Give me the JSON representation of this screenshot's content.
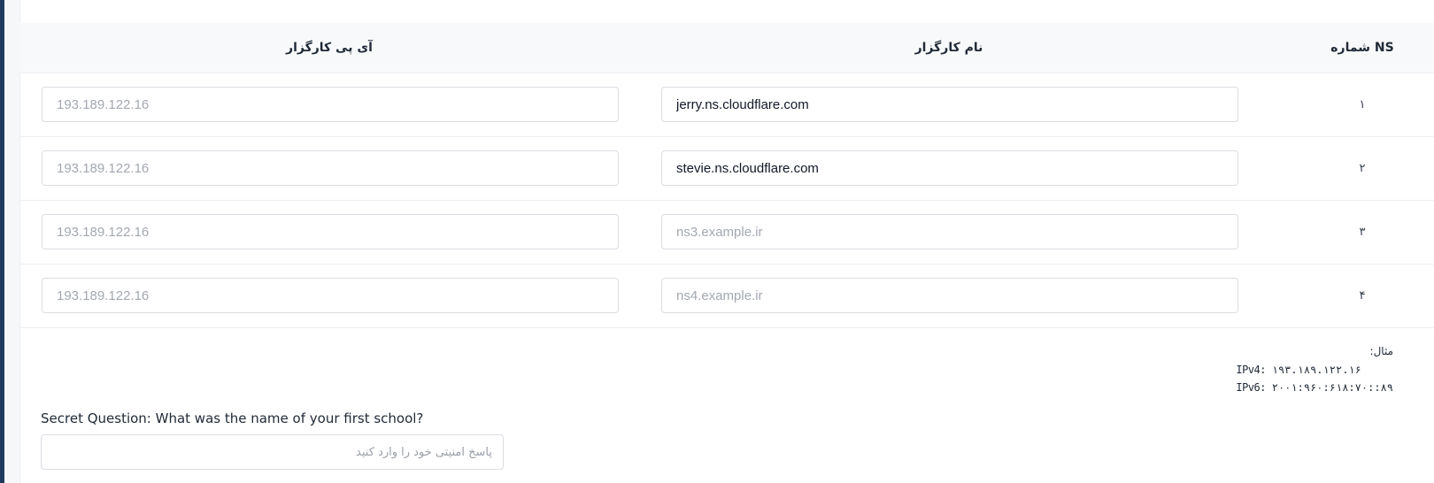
{
  "table": {
    "headers": {
      "number": "شماره NS",
      "name": "نام کارگزار",
      "ip": "آی پی کارگزار"
    },
    "rows": [
      {
        "number": "۱",
        "name_value": "jerry.ns.cloudflare.com",
        "name_placeholder": "",
        "ip_value": "",
        "ip_placeholder": "193.189.122.16"
      },
      {
        "number": "۲",
        "name_value": "stevie.ns.cloudflare.com",
        "name_placeholder": "",
        "ip_value": "",
        "ip_placeholder": "193.189.122.16"
      },
      {
        "number": "۳",
        "name_value": "",
        "name_placeholder": "ns3.example.ir",
        "ip_value": "",
        "ip_placeholder": "193.189.122.16"
      },
      {
        "number": "۴",
        "name_value": "",
        "name_placeholder": "ns4.example.ir",
        "ip_value": "",
        "ip_placeholder": "193.189.122.16"
      }
    ]
  },
  "example": {
    "title": "مثال:",
    "ipv4": "IPv4: ۱۹۳.۱۸۹.۱۲۲.۱۶",
    "ipv6": "IPv6: ۲۰۰۱:۹۶۰:۶۱۸:۷۰::۸۹"
  },
  "secret": {
    "label": "Secret Question: What was the name of your first school?",
    "placeholder": "پاسخ امنیتی خود را وارد کنید"
  }
}
